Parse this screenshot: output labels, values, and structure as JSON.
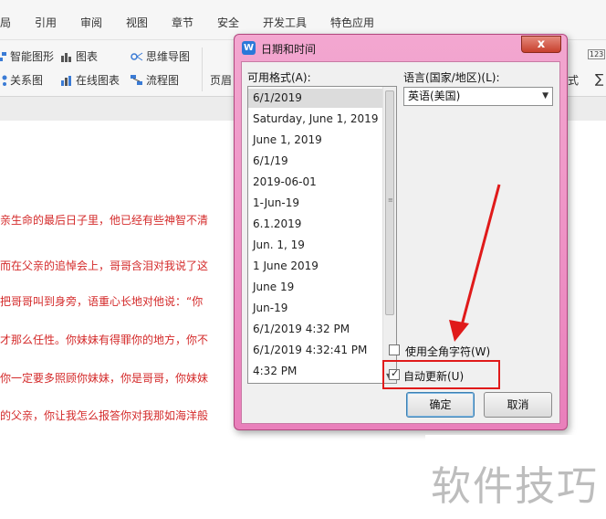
{
  "menubar": {
    "items": [
      "局",
      "引用",
      "审阅",
      "视图",
      "章节",
      "安全",
      "开发工具",
      "特色应用"
    ]
  },
  "ribbon": {
    "smart_shape": "智能图形",
    "chart": "图表",
    "mindmap": "思维导图",
    "relation_chart": "关系图",
    "online_chart": "在线图表",
    "flowchart": "流程图",
    "header_footer": "页眉",
    "right_a": "式",
    "right_b": "∑",
    "right_c": "123"
  },
  "document": {
    "lines": [
      "亲生命的最后日子里，他已经有些神智不清",
      "而在父亲的追悼会上，哥哥含泪对我说了这",
      "把哥哥叫到身旁，语重心长地对他说：“你",
      "才那么任性。你妹妹有得罪你的地方，你不",
      "你一定要多照顾你妹妹，你是哥哥，你妹妹",
      "的父亲，你让我怎么报答你对我那如海洋般"
    ]
  },
  "dialog": {
    "icon_letter": "W",
    "title": "日期和时间",
    "close_glyph": "x",
    "formats_label": "可用格式(A):",
    "formats": [
      "6/1/2019",
      "Saturday, June 1, 2019",
      "June 1, 2019",
      "6/1/19",
      "2019-06-01",
      "1-Jun-19",
      "6.1.2019",
      "Jun. 1, 19",
      "1 June 2019",
      "June 19",
      "Jun-19",
      "6/1/2019 4:32 PM",
      "6/1/2019 4:32:41 PM",
      "4:32 PM"
    ],
    "selected_index": 0,
    "language_label": "语言(国家/地区)(L):",
    "language_value": "英语(美国)",
    "fullwidth_label": "使用全角字符(W)",
    "fullwidth_checked": false,
    "autoupdate_label": "自动更新(U)",
    "autoupdate_checked": true,
    "ok_label": "确定",
    "cancel_label": "取消"
  },
  "watermark": "软件技巧",
  "colors": {
    "dialog_frame": "#ef93c6",
    "doc_text": "#d42a2a",
    "annotation": "#e01a1a"
  }
}
